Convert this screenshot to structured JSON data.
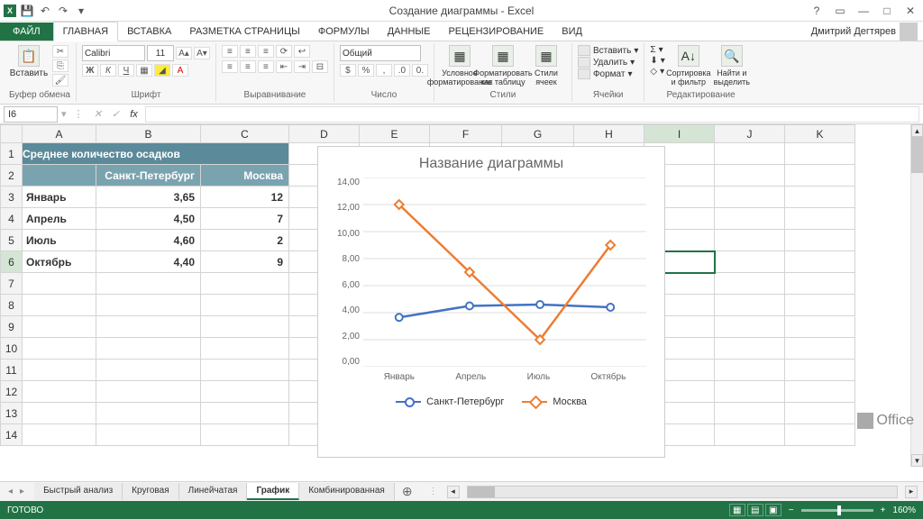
{
  "app": {
    "title_doc": "Создание диаграммы",
    "title_app": "Excel",
    "user": "Дмитрий Дегтярев"
  },
  "ribbon": {
    "file_tab": "ФАЙЛ",
    "tabs": [
      "ГЛАВНАЯ",
      "ВСТАВКА",
      "РАЗМЕТКА СТРАНИЦЫ",
      "ФОРМУЛЫ",
      "ДАННЫЕ",
      "РЕЦЕНЗИРОВАНИЕ",
      "ВИД"
    ],
    "active_tab": "ГЛАВНАЯ",
    "groups": {
      "clipboard": "Буфер обмена",
      "paste": "Вставить",
      "font_group": "Шрифт",
      "font_name": "Calibri",
      "font_size": "11",
      "align_group": "Выравнивание",
      "number_group": "Число",
      "number_format": "Общий",
      "styles_group": "Стили",
      "cond_fmt": "Условное форматирование",
      "fmt_table": "Форматировать как таблицу",
      "cell_styles": "Стили ячеек",
      "cells_group": "Ячейки",
      "insert": "Вставить",
      "delete": "Удалить",
      "format": "Формат",
      "editing_group": "Редактирование",
      "sort": "Сортировка и фильтр",
      "find": "Найти и выделить"
    }
  },
  "formula": {
    "name_box": "I6",
    "fx": "fx"
  },
  "grid": {
    "columns": [
      "A",
      "B",
      "C",
      "D",
      "E",
      "F",
      "G",
      "H",
      "I",
      "J",
      "K"
    ],
    "row_count": 14,
    "data_header": "Среднее количество осадков",
    "col1": "Санкт-Петербург",
    "col2": "Москва",
    "rows": [
      {
        "m": "Январь",
        "v1": "3,65",
        "v2": "12"
      },
      {
        "m": "Апрель",
        "v1": "4,50",
        "v2": "7"
      },
      {
        "m": "Июль",
        "v1": "4,60",
        "v2": "2"
      },
      {
        "m": "Октябрь",
        "v1": "4,40",
        "v2": "9"
      }
    ]
  },
  "chart": {
    "title": "Название диаграммы",
    "y_ticks": [
      "14,00",
      "12,00",
      "10,00",
      "8,00",
      "6,00",
      "4,00",
      "2,00",
      "0,00"
    ],
    "x_labels": [
      "Январь",
      "Апрель",
      "Июль",
      "Октябрь"
    ],
    "legend": [
      "Санкт-Петербург",
      "Москва"
    ]
  },
  "chart_data": {
    "type": "line",
    "title": "Название диаграммы",
    "categories": [
      "Январь",
      "Апрель",
      "Июль",
      "Октябрь"
    ],
    "series": [
      {
        "name": "Санкт-Петербург",
        "values": [
          3.65,
          4.5,
          4.6,
          4.4
        ],
        "color": "#4472c4"
      },
      {
        "name": "Москва",
        "values": [
          12,
          7,
          2,
          9
        ],
        "color": "#ed7d31"
      }
    ],
    "xlabel": "",
    "ylabel": "",
    "ylim": [
      0,
      14
    ]
  },
  "sheet_tabs": {
    "tabs": [
      "Быстрый анализ",
      "Круговая",
      "Линейчатая",
      "График",
      "Комбинированная"
    ],
    "active": "График"
  },
  "status": {
    "ready": "ГОТОВО",
    "zoom": "160%"
  },
  "office_logo": "Office"
}
